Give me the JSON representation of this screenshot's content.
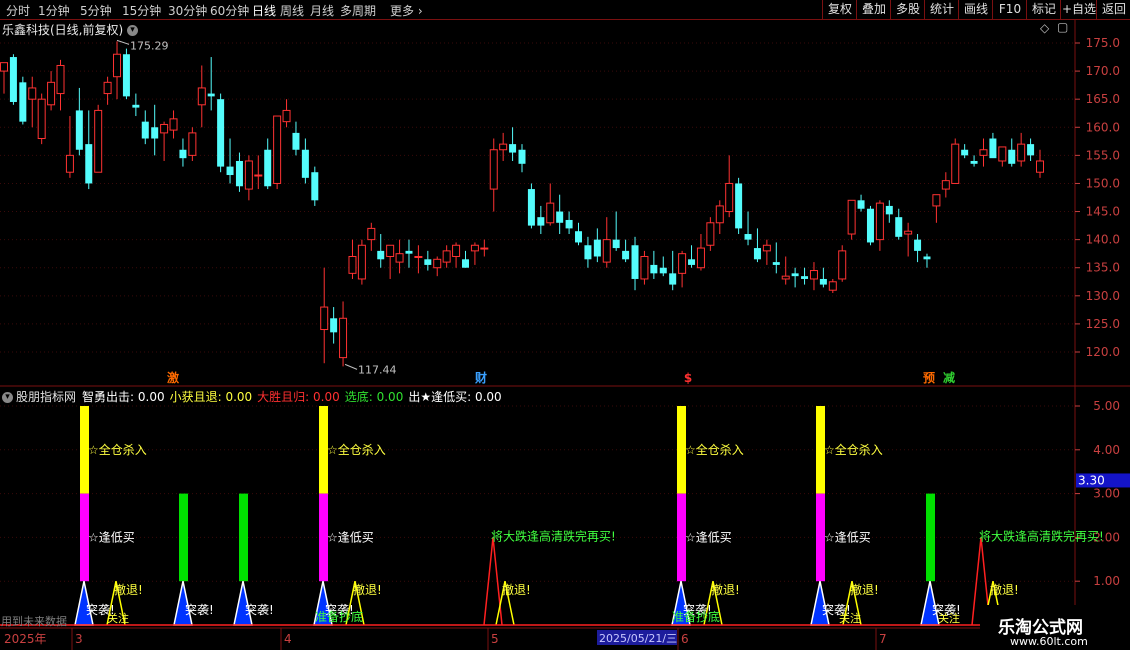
{
  "toolbar": {
    "timeframes": [
      "分时",
      "1分钟",
      "5分钟",
      "15分钟",
      "30分钟",
      "60分钟",
      "日线",
      "周线",
      "月线",
      "多周期",
      "更多"
    ],
    "active": "日线",
    "more_chevron": "›",
    "right_buttons": [
      "复权",
      "叠加",
      "多股",
      "统计",
      "画线",
      "F10",
      "标记",
      "+自选",
      "返回"
    ]
  },
  "main_title": "乐鑫科技(日线,前复权)",
  "main_title_icon": "circle-chevron-down-icon",
  "diamond_icon": "◇",
  "restore_icon": "▢",
  "price_axis": {
    "ticks": [
      "175.0",
      "170.0",
      "165.0",
      "160.0",
      "155.0",
      "150.0",
      "145.0",
      "140.0",
      "135.0",
      "130.0",
      "125.0",
      "120.0"
    ]
  },
  "annotations": {
    "high": "175.29",
    "low": "117.44"
  },
  "events": [
    {
      "text": "激",
      "color": "#ff6a00"
    },
    {
      "text": "财",
      "color": "#3aa0ff"
    },
    {
      "text": "$",
      "color": "#ff3030"
    },
    {
      "text": "预",
      "color": "#ff6a00"
    },
    {
      "text": "减",
      "color": "#30d030"
    }
  ],
  "indicator": {
    "name": "股朋指标网",
    "items": [
      {
        "label": "智勇出击:",
        "value": "0.00",
        "color": "#ffffff"
      },
      {
        "label": "小获且退:",
        "value": "0.00",
        "color": "#ffff40"
      },
      {
        "label": "大胜且归:",
        "value": "0.00",
        "color": "#ff3030"
      },
      {
        "label": "选底:",
        "value": "0.00",
        "color": "#30e030"
      },
      {
        "label": "出★逢低买:",
        "value": "0.00",
        "color": "#ffffff"
      }
    ],
    "axis_ticks": [
      "5.00",
      "4.00",
      "3.00",
      "2.00",
      "1.00"
    ],
    "current_value": "3.30",
    "labels": {
      "buy_all": "☆全仓杀入",
      "low_buy": "☆逢低买",
      "retreat": "撤退!",
      "attack": "突袭!",
      "watch": "关注",
      "bottom": "准备抄底",
      "big_fall": "将大跌逢高清跌完再买!"
    }
  },
  "timeline": {
    "year": "2025年",
    "months": [
      "3",
      "4",
      "5",
      "6",
      "7"
    ],
    "date_marker": "2025/05/21/三"
  },
  "note": "用到未来数据",
  "watermark": {
    "title": "乐淘公式网",
    "url": "www.60lt.com"
  },
  "colors": {
    "up": "#ff3232",
    "down": "#54fcfc",
    "grid": "#7a1010",
    "axis_text": "#c84040",
    "yellow": "#ffff00",
    "magenta": "#ff00ff",
    "green": "#00e000",
    "blue": "#0033ff"
  },
  "chart_data": {
    "type": "candlestick",
    "y_range": [
      117.44,
      175.29
    ],
    "candles": [
      [
        170.0,
        171.5,
        166.0,
        171.5
      ],
      [
        172.5,
        173.0,
        164.0,
        164.5
      ],
      [
        168.0,
        169.0,
        160.5,
        161.0
      ],
      [
        165.0,
        169.0,
        160.0,
        167.0
      ],
      [
        158.0,
        166.0,
        157.0,
        165.0
      ],
      [
        164.0,
        170.0,
        163.0,
        168.0
      ],
      [
        166.0,
        172.0,
        163.0,
        171.0
      ],
      [
        152.0,
        162.0,
        151.0,
        155.0
      ],
      [
        163.0,
        167.0,
        155.0,
        156.0
      ],
      [
        157.0,
        163.0,
        149.0,
        150.0
      ],
      [
        152.0,
        164.0,
        152.0,
        163.0
      ],
      [
        166.0,
        169.0,
        164.0,
        168.0
      ],
      [
        169.0,
        175.29,
        165.0,
        173.0
      ],
      [
        173.0,
        174.0,
        165.0,
        165.5
      ],
      [
        164.0,
        166.0,
        162.0,
        163.5
      ],
      [
        161.0,
        163.0,
        157.0,
        158.0
      ],
      [
        160.0,
        164.0,
        155.0,
        158.0
      ],
      [
        159.0,
        161.0,
        154.0,
        160.5
      ],
      [
        159.5,
        163.0,
        158.0,
        161.5
      ],
      [
        156.0,
        158.0,
        153.0,
        154.5
      ],
      [
        155.0,
        160.0,
        154.0,
        159.0
      ],
      [
        164.0,
        171.0,
        160.0,
        167.0
      ],
      [
        166.0,
        172.5,
        163.0,
        165.5
      ],
      [
        165.0,
        166.0,
        152.0,
        153.0
      ],
      [
        153.0,
        158.0,
        150.0,
        151.5
      ],
      [
        154.0,
        155.5,
        148.5,
        149.5
      ],
      [
        149.0,
        155.0,
        147.0,
        154.0
      ],
      [
        151.5,
        155.0,
        149.0,
        151.5
      ],
      [
        156.0,
        158.0,
        149.0,
        149.5
      ],
      [
        150.0,
        162.0,
        149.0,
        162.0
      ],
      [
        161.0,
        165.0,
        160.0,
        163.0
      ],
      [
        159.0,
        161.0,
        155.0,
        156.0
      ],
      [
        156.0,
        158.0,
        150.0,
        151.0
      ],
      [
        152.0,
        153.0,
        146.0,
        147.0
      ],
      [
        124.0,
        135.0,
        118.0,
        128.0
      ],
      [
        126.0,
        128.0,
        121.5,
        123.5
      ],
      [
        119.0,
        129.0,
        117.44,
        126.0
      ],
      [
        134.0,
        140.0,
        133.0,
        137.0
      ],
      [
        133.0,
        140.0,
        132.0,
        139.0
      ],
      [
        140.0,
        143.0,
        138.0,
        142.0
      ],
      [
        138.0,
        141.0,
        135.0,
        136.5
      ],
      [
        137.0,
        139.0,
        133.0,
        139.0
      ],
      [
        136.0,
        140.0,
        134.0,
        137.5
      ],
      [
        138.0,
        140.0,
        135.0,
        137.5
      ],
      [
        137.0,
        139.0,
        134.0,
        137.0
      ],
      [
        136.5,
        138.0,
        134.5,
        135.5
      ],
      [
        135.0,
        137.0,
        133.5,
        136.5
      ],
      [
        136.0,
        139.0,
        135.0,
        138.0
      ],
      [
        137.0,
        139.5,
        135.0,
        139.0
      ],
      [
        136.5,
        138.0,
        135.0,
        135.0
      ],
      [
        138.0,
        139.5,
        135.5,
        139.0
      ],
      [
        138.5,
        140.0,
        137.0,
        138.5
      ],
      [
        149.0,
        158.0,
        145.0,
        156.0
      ],
      [
        156.0,
        159.0,
        154.0,
        157.0
      ],
      [
        157.0,
        160.0,
        154.0,
        155.5
      ],
      [
        156.0,
        157.0,
        152.0,
        153.5
      ],
      [
        149.0,
        150.0,
        142.0,
        142.5
      ],
      [
        144.0,
        146.0,
        141.0,
        142.5
      ],
      [
        143.0,
        150.0,
        142.5,
        146.5
      ],
      [
        145.0,
        148.0,
        141.0,
        143.0
      ],
      [
        143.5,
        145.0,
        141.0,
        142.0
      ],
      [
        141.5,
        143.0,
        139.0,
        139.5
      ],
      [
        139.0,
        140.5,
        135.0,
        136.5
      ],
      [
        140.0,
        142.0,
        136.0,
        137.0
      ],
      [
        136.0,
        144.0,
        135.0,
        140.0
      ],
      [
        140.0,
        145.0,
        138.0,
        138.5
      ],
      [
        138.0,
        140.0,
        136.0,
        136.5
      ],
      [
        139.0,
        140.5,
        131.0,
        133.0
      ],
      [
        133.0,
        138.0,
        132.0,
        137.0
      ],
      [
        135.5,
        138.0,
        133.0,
        134.0
      ],
      [
        135.0,
        137.0,
        133.5,
        134.0
      ],
      [
        134.0,
        138.0,
        131.0,
        132.0
      ],
      [
        134.0,
        138.0,
        131.5,
        137.5
      ],
      [
        136.5,
        139.0,
        135.0,
        135.5
      ],
      [
        135.0,
        141.0,
        134.5,
        138.5
      ],
      [
        139.0,
        144.0,
        138.0,
        143.0
      ],
      [
        143.0,
        147.0,
        141.0,
        146.0
      ],
      [
        145.0,
        155.0,
        144.0,
        150.0
      ],
      [
        150.0,
        151.0,
        141.0,
        142.0
      ],
      [
        141.0,
        145.0,
        139.0,
        140.0
      ],
      [
        138.5,
        142.0,
        136.0,
        136.5
      ],
      [
        138.0,
        140.0,
        135.5,
        139.0
      ],
      [
        136.0,
        139.5,
        134.0,
        135.5
      ],
      [
        133.0,
        137.0,
        132.0,
        133.5
      ],
      [
        134.0,
        135.0,
        131.5,
        133.5
      ],
      [
        133.5,
        135.0,
        132.0,
        133.0
      ],
      [
        133.0,
        136.0,
        131.0,
        134.5
      ],
      [
        133.0,
        135.0,
        131.5,
        132.0
      ],
      [
        131.0,
        133.0,
        130.5,
        132.5
      ],
      [
        133.0,
        139.0,
        132.5,
        138.0
      ],
      [
        141.0,
        147.0,
        140.0,
        147.0
      ],
      [
        147.0,
        148.0,
        145.0,
        145.5
      ],
      [
        145.5,
        146.0,
        139.0,
        139.5
      ],
      [
        140.0,
        147.0,
        138.0,
        146.5
      ],
      [
        146.0,
        147.0,
        143.0,
        144.5
      ],
      [
        144.0,
        145.5,
        140.0,
        140.5
      ],
      [
        141.0,
        143.0,
        137.0,
        141.5
      ],
      [
        140.0,
        141.0,
        136.0,
        138.0
      ],
      [
        137.0,
        137.5,
        135.0,
        136.5
      ],
      [
        146.0,
        148.0,
        143.0,
        148.0
      ],
      [
        149.0,
        152.0,
        147.5,
        150.5
      ],
      [
        150.0,
        158.0,
        150.0,
        157.0
      ],
      [
        156.0,
        157.0,
        154.5,
        155.0
      ],
      [
        154.0,
        155.0,
        153.0,
        153.5
      ],
      [
        155.0,
        158.0,
        153.0,
        156.0
      ],
      [
        158.0,
        159.0,
        155.0,
        154.5
      ],
      [
        154.0,
        156.0,
        153.0,
        156.5
      ],
      [
        156.0,
        158.0,
        153.0,
        153.5
      ],
      [
        154.0,
        159.0,
        153.0,
        157.0
      ],
      [
        157.0,
        158.0,
        154.0,
        155.0
      ],
      [
        152.0,
        156.0,
        151.0,
        154.0
      ]
    ],
    "indicator_signals": [
      {
        "stack": [
          0,
          1,
          1,
          1,
          1,
          1,
          0,
          0
        ],
        "levels": {
          "blue": 1.0,
          "magenta": 2.0,
          "yellow": 3.0
        }
      },
      {
        "stack": [
          0,
          0,
          0,
          0,
          0,
          0,
          0,
          0
        ],
        "levels": {
          "green": 2.0
        }
      },
      {
        "stack": [
          0,
          0,
          0,
          0,
          0,
          0,
          0,
          0
        ],
        "levels": {
          "green": 2.0
        }
      }
    ]
  }
}
